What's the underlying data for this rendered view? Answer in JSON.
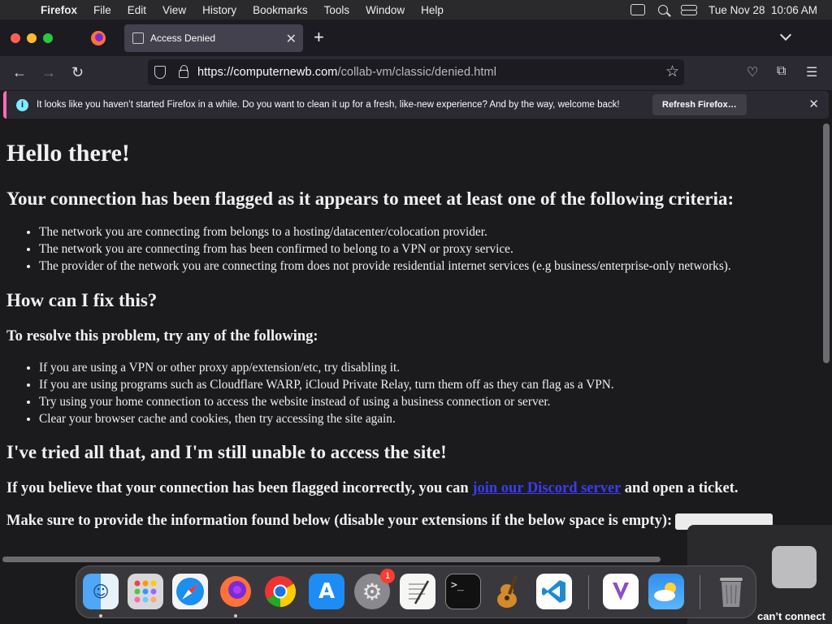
{
  "menubar": {
    "app_name": "Firefox",
    "items": [
      "File",
      "Edit",
      "View",
      "History",
      "Bookmarks",
      "Tools",
      "Window",
      "Help"
    ],
    "datetime": "Tue Nov 28  10:06 AM"
  },
  "tab": {
    "title": "Access Denied"
  },
  "url": {
    "host": "https://computernewb.com",
    "path": "/collab-vm/classic/denied.html"
  },
  "notice": {
    "text": "It looks like you haven’t started Firefox in a while. Do you want to clean it up for a fresh, like-new experience? And by the way, welcome back!",
    "button": "Refresh Firefox…"
  },
  "page": {
    "heading": "Hello there!",
    "flagged_heading": "Your connection has been flagged as it appears to meet at least one of the following criteria:",
    "criteria": [
      "The network you are connecting from belongs to a hosting/datacenter/colocation provider.",
      "The network you are connecting from has been confirmed to belong to a VPN or proxy service.",
      "The provider of the network you are connecting from does not provide residential internet services (e.g business/enterprise-only networks)."
    ],
    "fix_heading": "How can I fix this?",
    "resolve_heading": "To resolve this problem, try any of the following:",
    "fixes": [
      "If you are using a VPN or other proxy app/extension/etc, try disabling it.",
      "If you are using programs such as Cloudflare WARP, iCloud Private Relay, turn them off as they can flag as a VPN.",
      "Try using your home connection to access the website instead of using a business connection or server.",
      "Clear your browser cache and cookies, then try accessing the site again."
    ],
    "tried_heading": "I've tried all that, and I'm still unable to access the site!",
    "flag_text_before": "If you believe that your connection has been flagged incorrectly, you can ",
    "discord_link": "join our Discord server",
    "flag_text_after": " and open a ticket.",
    "info_text": "Make sure to provide the information found below (disable your extensions if the below space is empty):"
  },
  "vm_overlay": {
    "text": "can’t connect"
  },
  "dock": {
    "apps": [
      "finder",
      "launchpad",
      "safari",
      "firefox",
      "chrome",
      "app-store",
      "system-settings",
      "textedit",
      "terminal",
      "garageband",
      "vscode",
      "visual-studio",
      "weather",
      "trash"
    ],
    "settings_badge": "1",
    "terminal_glyph": ">_"
  }
}
